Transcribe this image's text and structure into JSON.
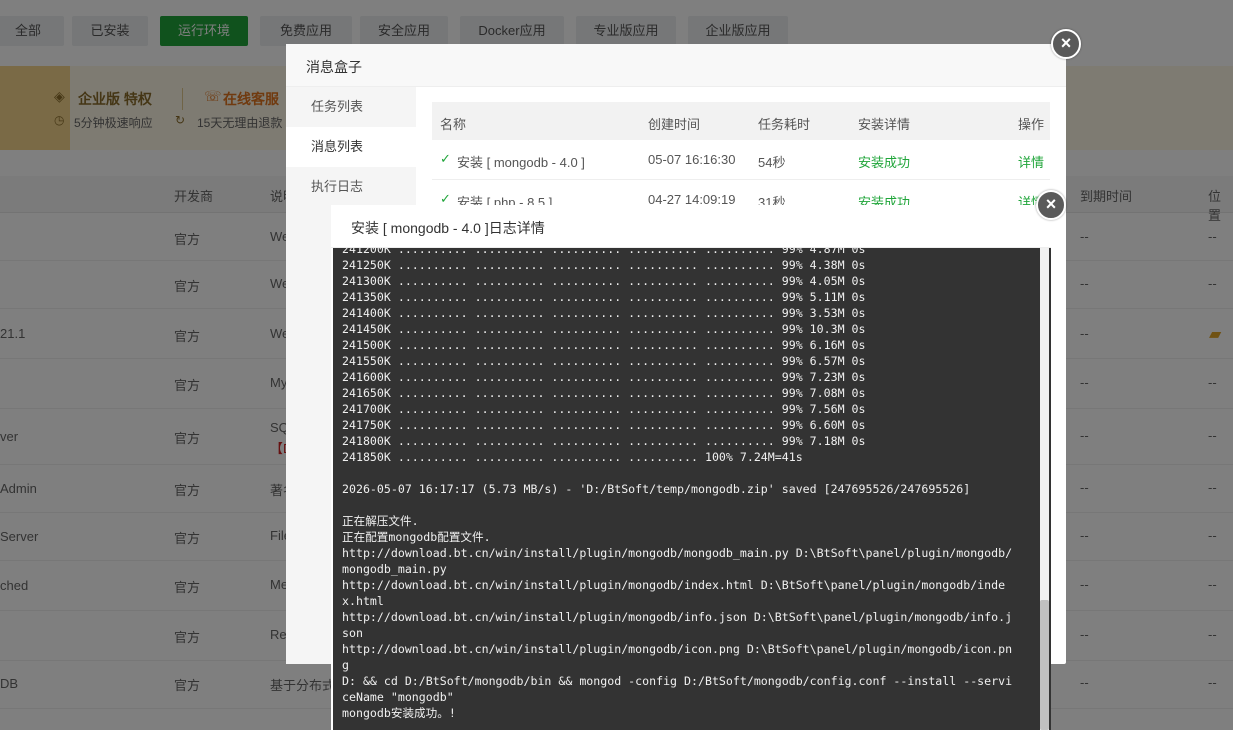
{
  "filter_tabs": [
    {
      "label": "全部"
    },
    {
      "label": "已安装"
    },
    {
      "label": "运行环境"
    },
    {
      "label": "免费应用"
    },
    {
      "label": "安全应用"
    },
    {
      "label": "Docker应用"
    },
    {
      "label": "专业版应用"
    },
    {
      "label": "企业版应用"
    }
  ],
  "active_tab_index": 2,
  "promo": {
    "enterprise_title": "企业版 特权",
    "enterprise_sub": "5分钟极速响应",
    "support_title": "在线客服",
    "support_sub": "15天无理由退款"
  },
  "table": {
    "headers": {
      "developer": "开发商",
      "desc": "说明",
      "expire": "到期时间",
      "location": "位置"
    },
    "rows": [
      {
        "name": "",
        "developer": "官方",
        "desc": "We",
        "expire": "--",
        "location": "--"
      },
      {
        "name": "",
        "developer": "官方",
        "desc": "We",
        "expire": "--",
        "location": "--"
      },
      {
        "name": "21.1",
        "developer": "官方",
        "desc": "We",
        "expire": "--",
        "location": "folder"
      },
      {
        "name": "",
        "developer": "官方",
        "desc": "My",
        "expire": "--",
        "location": "--"
      },
      {
        "name": "ver",
        "developer": "官方",
        "desc": "SQ",
        "desc2": "【D",
        "expire": "--",
        "location": "--"
      },
      {
        "name": "Admin",
        "developer": "官方",
        "desc": "著名",
        "expire": "--",
        "location": "--"
      },
      {
        "name": "Server",
        "developer": "官方",
        "desc": "File",
        "expire": "--",
        "location": "--"
      },
      {
        "name": "ched",
        "developer": "官方",
        "desc": "Me",
        "expire": "--",
        "location": "--"
      },
      {
        "name": "",
        "developer": "官方",
        "desc": "Red",
        "expire": "--",
        "location": "--"
      },
      {
        "name": "DB",
        "developer": "官方",
        "desc": "基于分布式",
        "expire": "--",
        "location": "--"
      }
    ]
  },
  "msgbox": {
    "title": "消息盒子",
    "nav": [
      {
        "label": "任务列表"
      },
      {
        "label": "消息列表"
      },
      {
        "label": "执行日志"
      }
    ],
    "active_nav_index": 1,
    "columns": {
      "name": "名称",
      "created": "创建时间",
      "duration": "任务耗时",
      "detail": "安装详情",
      "action": "操作"
    },
    "tasks": [
      {
        "name": "安装 [ mongodb - 4.0 ]",
        "created": "05-07 16:16:30",
        "duration": "54秒",
        "status": "安装成功",
        "action": "详情"
      },
      {
        "name": "安装 [ php - 8.5 ]",
        "created": "04-27 14:09:19",
        "duration": "31秒",
        "status": "安装成功",
        "action": "详情"
      }
    ]
  },
  "log": {
    "title": "安装 [ mongodb - 4.0 ]日志详情",
    "content": "241200K .......... .......... .......... .......... .......... 99% 4.87M 0s\n241250K .......... .......... .......... .......... .......... 99% 4.38M 0s\n241300K .......... .......... .......... .......... .......... 99% 4.05M 0s\n241350K .......... .......... .......... .......... .......... 99% 5.11M 0s\n241400K .......... .......... .......... .......... .......... 99% 3.53M 0s\n241450K .......... .......... .......... .......... .......... 99% 10.3M 0s\n241500K .......... .......... .......... .......... .......... 99% 6.16M 0s\n241550K .......... .......... .......... .......... .......... 99% 6.57M 0s\n241600K .......... .......... .......... .......... .......... 99% 7.23M 0s\n241650K .......... .......... .......... .......... .......... 99% 7.08M 0s\n241700K .......... .......... .......... .......... .......... 99% 7.56M 0s\n241750K .......... .......... .......... .......... .......... 99% 6.60M 0s\n241800K .......... .......... .......... .......... .......... 99% 7.18M 0s\n241850K .......... .......... .......... .......... 100% 7.24M=41s\n\n2026-05-07 16:17:17 (5.73 MB/s) - 'D:/BtSoft/temp/mongodb.zip' saved [247695526/247695526]\n\n正在解压文件.\n正在配置mongodb配置文件.\nhttp://download.bt.cn/win/install/plugin/mongodb/mongodb_main.py D:\\BtSoft\\panel/plugin/mongodb/\nmongodb_main.py\nhttp://download.bt.cn/win/install/plugin/mongodb/index.html D:\\BtSoft\\panel/plugin/mongodb/inde\nx.html\nhttp://download.bt.cn/win/install/plugin/mongodb/info.json D:\\BtSoft\\panel/plugin/mongodb/info.j\nson\nhttp://download.bt.cn/win/install/plugin/mongodb/icon.png D:\\BtSoft\\panel/plugin/mongodb/icon.pn\ng\nD: && cd D:/BtSoft/mongodb/bin && mongod -config D:/BtSoft/mongodb/config.conf --install --servi\nceName \"mongodb\"\nmongodb安装成功。!"
  },
  "colors": {
    "accent": "#20a53a",
    "console_bg": "#333333",
    "promo_bg": "#fdf6e4"
  }
}
